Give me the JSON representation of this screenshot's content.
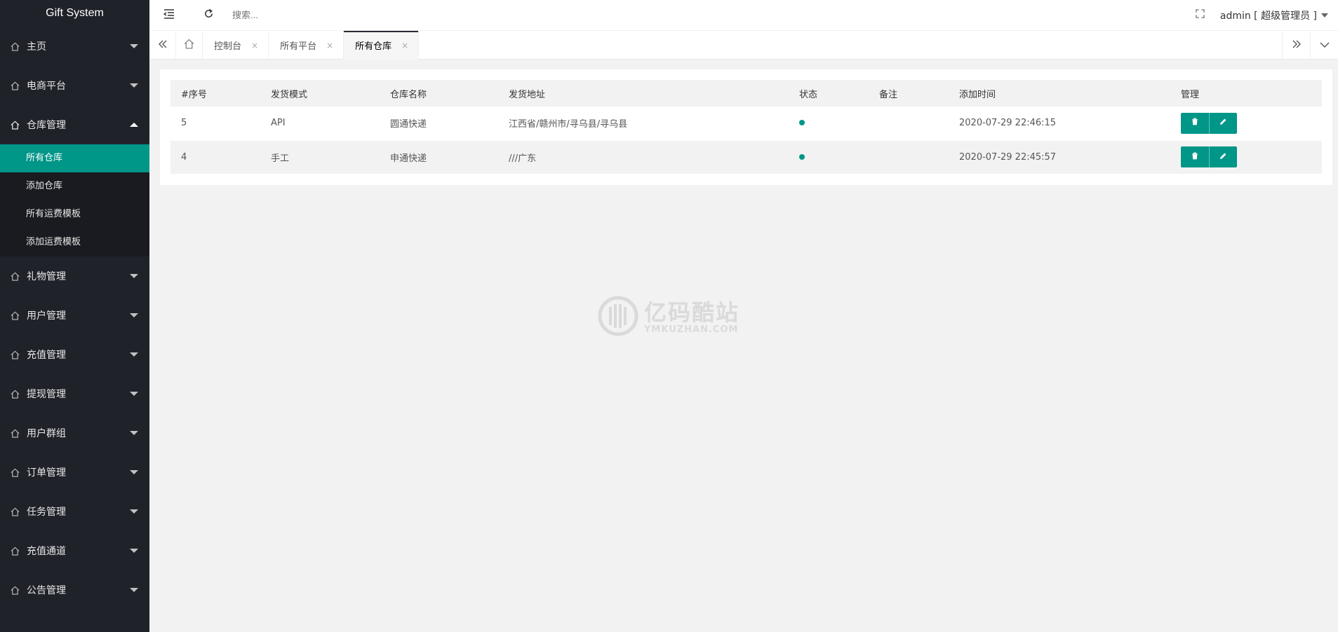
{
  "app": {
    "title": "Gift System"
  },
  "topbar": {
    "search_placeholder": "搜索...",
    "user_label": "admin [ 超级管理员 ]"
  },
  "sidebar": {
    "items_top": [
      {
        "label": "主页"
      },
      {
        "label": "电商平台"
      },
      {
        "label": "仓库管理"
      }
    ],
    "sub_items": [
      {
        "label": "所有仓库"
      },
      {
        "label": "添加仓库"
      },
      {
        "label": "所有运费模板"
      },
      {
        "label": "添加运费模板"
      }
    ],
    "items_bottom": [
      {
        "label": "礼物管理"
      },
      {
        "label": "用户管理"
      },
      {
        "label": "充值管理"
      },
      {
        "label": "提现管理"
      },
      {
        "label": "用户群组"
      },
      {
        "label": "订单管理"
      },
      {
        "label": "任务管理"
      },
      {
        "label": "充值通道"
      },
      {
        "label": "公告管理"
      }
    ]
  },
  "tabs": [
    {
      "label": "控制台",
      "close": "×"
    },
    {
      "label": "所有平台",
      "close": "×"
    },
    {
      "label": "所有仓库",
      "close": "×"
    }
  ],
  "table": {
    "headers": [
      "#序号",
      "发货模式",
      "仓库名称",
      "发货地址",
      "状态",
      "备注",
      "添加时间",
      "管理"
    ],
    "rows": [
      {
        "id": "5",
        "mode": "API",
        "name": "圆通快递",
        "address": "江西省/赣州市/寻乌县/寻乌县",
        "note": "",
        "time": "2020-07-29 22:46:15"
      },
      {
        "id": "4",
        "mode": "手工",
        "name": "申通快递",
        "address": "///广东",
        "note": "",
        "time": "2020-07-29 22:45:57"
      }
    ]
  },
  "watermark": {
    "cn": "亿码酷站",
    "en": "YMKUZHAN.COM"
  },
  "colors": {
    "accent": "#009688",
    "sidebar": "#20222a"
  }
}
